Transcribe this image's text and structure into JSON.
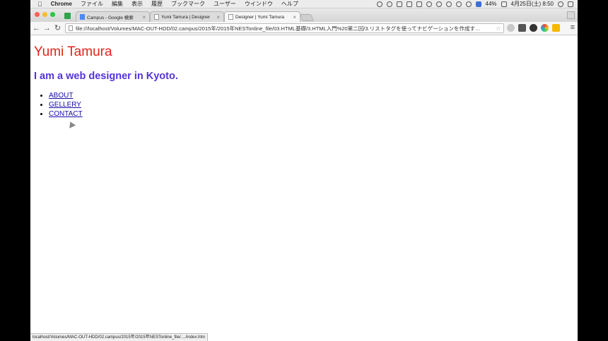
{
  "menubar": {
    "app_name": "Chrome",
    "items": [
      "ファイル",
      "編集",
      "表示",
      "履歴",
      "ブックマーク",
      "ユーザー",
      "ウインドウ",
      "ヘルプ"
    ],
    "battery": "44%",
    "datetime": "4月25日(土) 8:50"
  },
  "tabs": [
    {
      "title": "Campus - Google 検索"
    },
    {
      "title": "Yumi Tamura | Designer"
    },
    {
      "title": "Designer | Yumi Tamura"
    }
  ],
  "address_bar": {
    "url": "file:///localhost/Volumes/MAC-OUT-HDD/02.campus/2015年/2015年NESTonline_file/03.HTML基礎/3.HTML入門%20第二回/3.リストタグを使ってナビゲーションを作成す…"
  },
  "page": {
    "title": "Yumi Tamura",
    "subtitle": "I am a web designer in Kyoto.",
    "nav": [
      "ABOUT",
      "GELLERY",
      "CONTACT"
    ]
  },
  "status_bar": {
    "text": "localhost/Volumes/MAC-OUT-HDD/02.campus/2015年/2015年NESTonline_file/..../index.htm"
  },
  "colors": {
    "title": "#e2231a",
    "subtitle": "#5533dd",
    "link": "#1a0dab"
  }
}
